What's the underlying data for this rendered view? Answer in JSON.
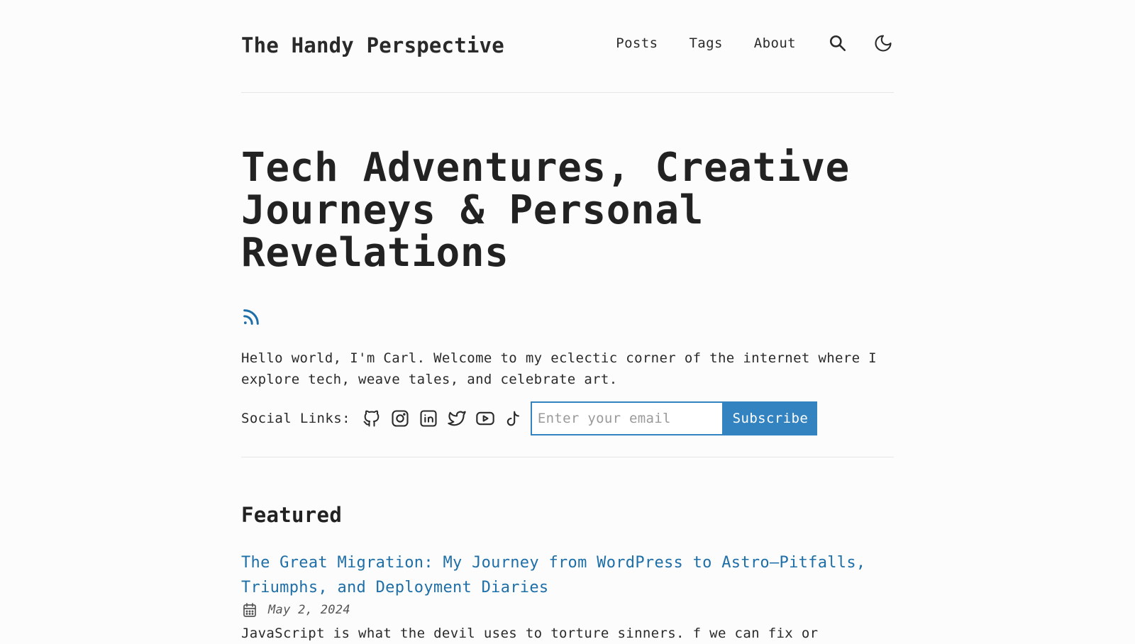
{
  "header": {
    "site_title": "The Handy Perspective",
    "nav": [
      {
        "label": "Posts"
      },
      {
        "label": "Tags"
      },
      {
        "label": "About"
      }
    ],
    "search_icon": "search-icon",
    "theme_icon": "moon-icon"
  },
  "hero": {
    "title": "Tech Adventures, Creative Journeys & Personal Revelations",
    "rss_icon": "rss-icon",
    "intro": "Hello world, I'm Carl. Welcome to my eclectic corner of the internet where I explore tech, weave tales, and celebrate art.",
    "social_label": "Social Links:",
    "social_icons": [
      "github-icon",
      "instagram-icon",
      "linkedin-icon",
      "twitter-icon",
      "youtube-icon",
      "tiktok-icon"
    ],
    "email_placeholder": "Enter your email",
    "subscribe_label": "Subscribe"
  },
  "featured": {
    "heading": "Featured",
    "post": {
      "title": "The Great Migration: My Journey from WordPress to Astro—Pitfalls, Triumphs, and Deployment Diaries",
      "date": "May 2, 2024",
      "excerpt": "JavaScript is what the devil uses to torture sinners. f we can fix or"
    }
  },
  "colors": {
    "accent": "#3383c1",
    "link": "#1e6fa8",
    "text": "#2a2a2a",
    "background": "#fcfcfc"
  }
}
